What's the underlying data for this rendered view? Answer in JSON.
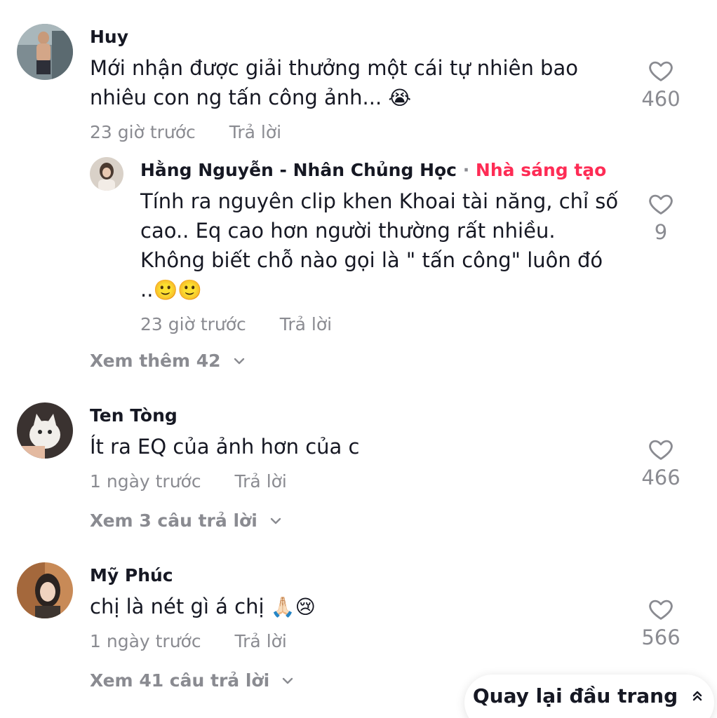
{
  "comments": [
    {
      "username": "Huy",
      "text_line1": "Mới nhận được giải thưởng một cái tự nhiên bao",
      "text_line2": "nhiêu con ng tấn công ảnh...",
      "emoji": "😭",
      "time": "23 giờ trước",
      "reply_label": "Trả lời",
      "likes": "460",
      "view_more": "Xem thêm 42",
      "reply": {
        "username": "Hằng Nguyễn - Nhân Chủng Học",
        "separator": " · ",
        "badge": "Nhà sáng tạo",
        "line1": "Tính ra nguyên clip khen Khoai tài năng, chỉ số",
        "line2": "cao.. Eq cao hơn người thường rất nhiều.",
        "line3": "Không biết chỗ nào gọi là \" tấn công\" luôn đó",
        "line4": "..",
        "emoji": "🙂🙂",
        "time": "23 giờ trước",
        "reply_label": "Trả lời",
        "likes": "9"
      }
    },
    {
      "username": "Ten Tòng",
      "text": "Ít ra EQ của ảnh hơn của c",
      "time": "1 ngày trước",
      "reply_label": "Trả lời",
      "likes": "466",
      "view_more": "Xem 3 câu trả lời"
    },
    {
      "username": "Mỹ Phúc",
      "text": "chị là nét gì á chị",
      "emoji": "🙏🏻😢",
      "time": "1 ngày trước",
      "reply_label": "Trả lời",
      "likes": "566",
      "view_more": "Xem 41 câu trả lời"
    }
  ],
  "back_to_top": "Quay lại đầu trang",
  "icons": {
    "heart": "heart-outline-icon",
    "chevron": "chevron-down-icon",
    "double_chevron_up": "double-chevron-up-icon"
  },
  "colors": {
    "text": "#161823",
    "muted": "#8a8b91",
    "creator": "#fe2c55"
  }
}
